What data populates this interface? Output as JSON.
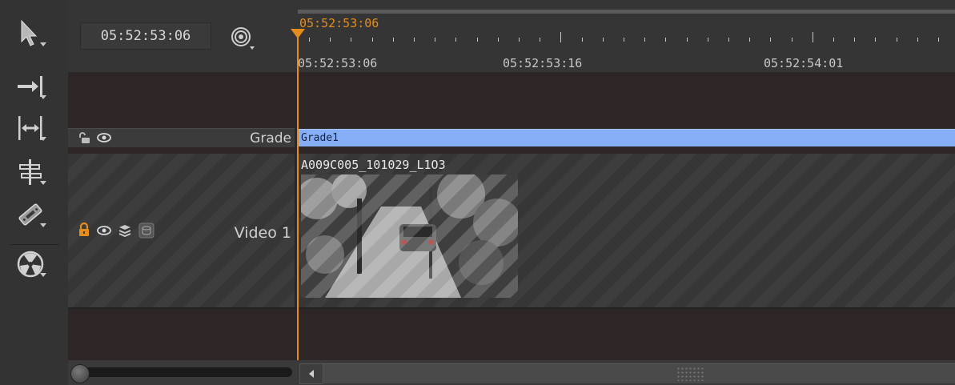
{
  "toolbar": {
    "tools": [
      {
        "name": "select-tool",
        "icon": "arrow-pointer-icon"
      },
      {
        "name": "multi-track-select-tool",
        "icon": "arrow-to-line-icon"
      },
      {
        "name": "slip-tool",
        "icon": "slip-icon"
      },
      {
        "name": "slide-tool",
        "icon": "slide-icon"
      },
      {
        "name": "razor-tool",
        "icon": "razor-icon"
      },
      {
        "name": "audio-tool",
        "icon": "radiation-icon"
      }
    ]
  },
  "header": {
    "current_timecode": "05:52:53:06",
    "snap_icon": "target-icon"
  },
  "ruler": {
    "playhead_timecode": "05:52:53:06",
    "labels": [
      "05:52:53:06",
      "05:52:53:16",
      "05:52:54:01"
    ]
  },
  "tracks": {
    "grade": {
      "name": "Grade",
      "clip_label": "Grade1",
      "clip_color": "#86aef7",
      "locked": false,
      "visible": true
    },
    "video1": {
      "name": "Video 1",
      "clip_label": "A009C005_101029_L1O3",
      "locked": true,
      "lock_color": "#e58c1c",
      "visible": true
    }
  },
  "colors": {
    "playhead": "#e58c1c",
    "grade_clip": "#86aef7"
  }
}
